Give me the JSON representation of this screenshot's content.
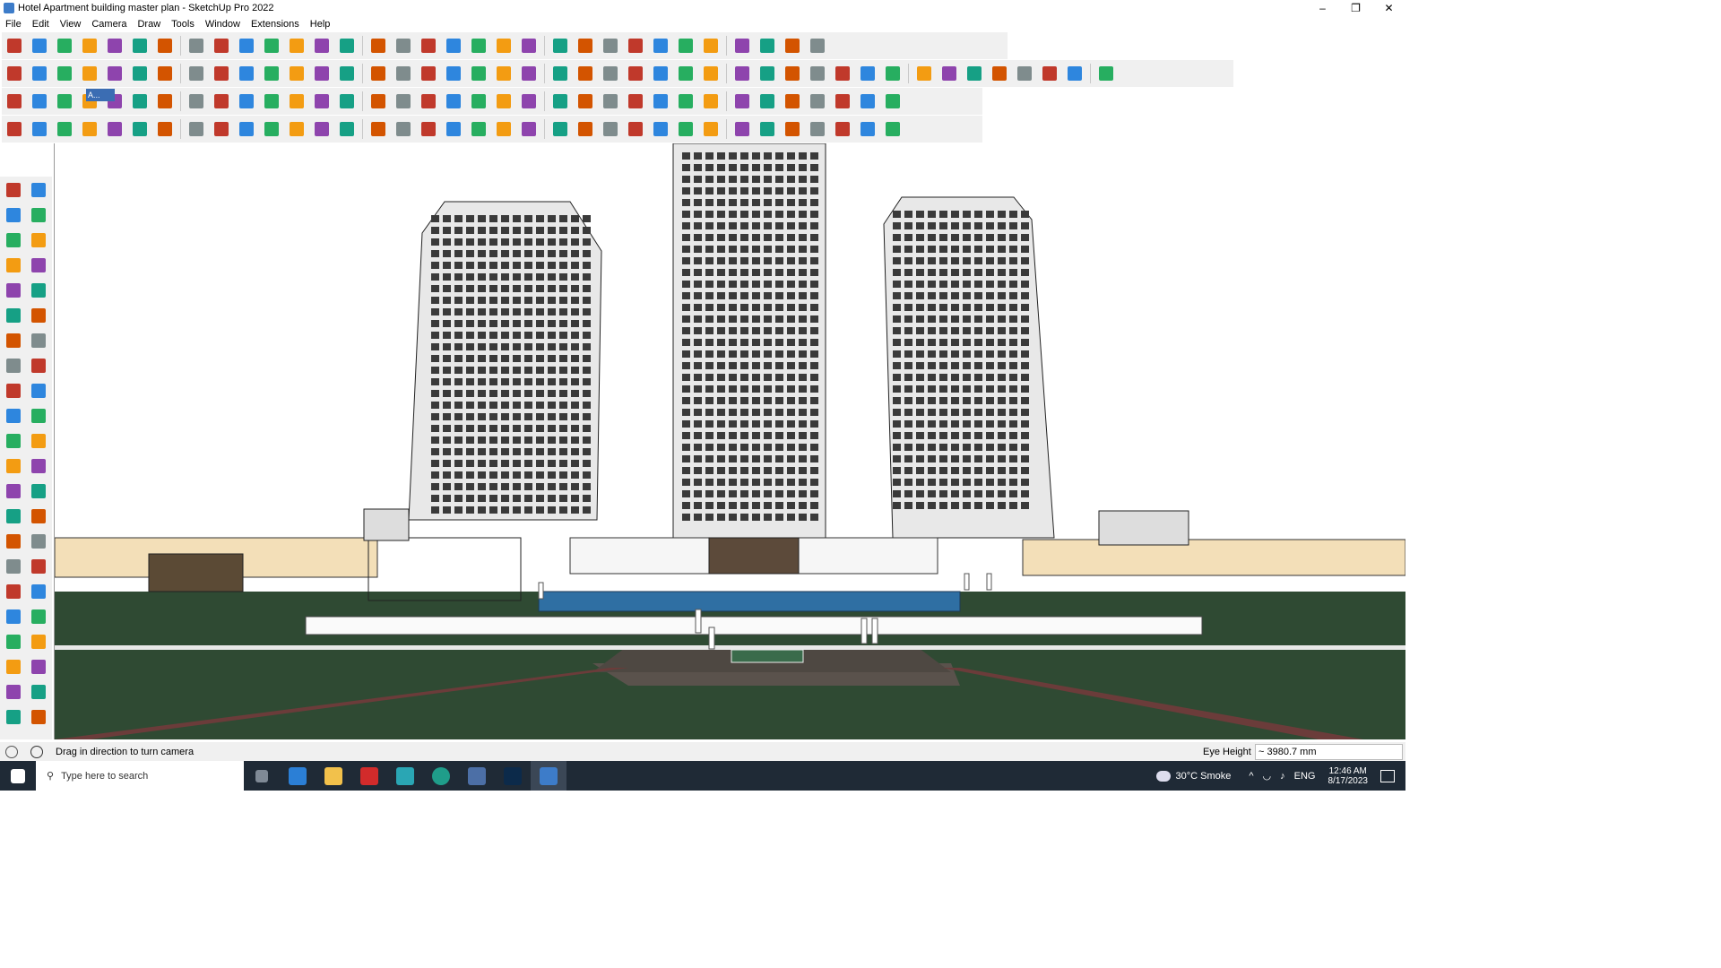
{
  "window": {
    "title": "Hotel Apartment building master plan - SketchUp Pro 2022",
    "controls": {
      "minimize": "–",
      "restore": "❐",
      "close": "✕"
    }
  },
  "menu": [
    "File",
    "Edit",
    "View",
    "Camera",
    "Draw",
    "Tools",
    "Window",
    "Extensions",
    "Help"
  ],
  "scene_tag": "A...",
  "status": {
    "message": "Drag in direction to turn camera",
    "eye_height_label": "Eye Height",
    "eye_height_value": "~ 3980.7 mm"
  },
  "taskbar": {
    "search_placeholder": "Type here to search",
    "weather": "30°C  Smoke",
    "language": "ENG",
    "time": "12:46 AM",
    "date": "8/17/2023"
  },
  "colors": {
    "toolbar_bg": "#f0f0f0",
    "grass": "#2f4a33",
    "pavement": "#5a524c",
    "building_facade": "#e8e8e8",
    "wall_beige": "#f3dfb8",
    "pool": "#2f6fa3",
    "taskbar": "#1f2a36"
  },
  "icons": {
    "top_row_1": [
      "zoom-icon",
      "select-icon",
      "eraser-icon",
      "pencil-icon",
      "freehand-icon",
      "rectangle-icon",
      "pushpull-icon",
      "followme-icon",
      "move-icon",
      "rotate-icon",
      "scale-icon",
      "tape-icon",
      "text-icon",
      "paint-icon",
      "orbit-icon",
      "pan-icon",
      "zoom-window-icon",
      "zoom-extents-icon",
      "section-icon",
      "layers-icon",
      "styles-icon",
      "outliner-icon",
      "user-icon",
      "walk-icon",
      "section-plane-icon",
      "arrows-updown-icon",
      "arrows-opposite-icon",
      "measure-icon",
      "bounds-icon",
      "undo-icon",
      "redo-icon",
      "component-icon"
    ],
    "top_row_2": [
      "box-icon",
      "box-shade-icon",
      "box-texture-icon",
      "explode-icon",
      "up-icon",
      "down-icon",
      "r-icon",
      "v-icon",
      "n-icon",
      "x-icon",
      "f-icon",
      "arc-icon",
      "slash-icon",
      "slash2-icon",
      "slash3-icon",
      "plane-icon",
      "plane2-icon",
      "roof-icon",
      "door-icon",
      "house-icon",
      "house-outline-icon",
      "garage-icon",
      "fe-icon",
      "curve-icon",
      "ruler-icon",
      "shape1-icon",
      "shape2-icon",
      "shape3-icon",
      "shape4-icon",
      "shape5-icon",
      "shape6-icon",
      "shape7-icon",
      "shape8-icon",
      "shape9-icon",
      "shape10-icon",
      "line-icon",
      "paint2-icon",
      "cube1-icon",
      "cube2-icon",
      "cube3-icon",
      "cube4-icon",
      "cube5-icon",
      "cube6-icon"
    ]
  }
}
